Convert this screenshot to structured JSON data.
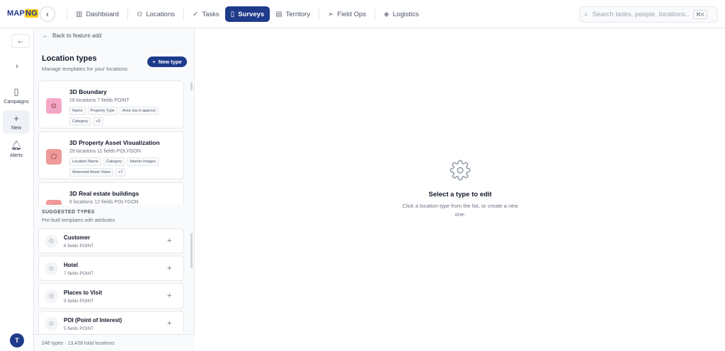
{
  "app": {
    "logo_main": "MAP",
    "logo_accent": "NG"
  },
  "nav": {
    "items": [
      {
        "label": "Dashboard",
        "icon": "bar-chart-icon",
        "active": false
      },
      {
        "label": "Locations",
        "icon": "map-pin-icon",
        "active": false
      },
      {
        "label": "Tasks",
        "icon": "check-icon",
        "active": false
      },
      {
        "label": "Surveys",
        "icon": "clipboard-icon",
        "active": true
      },
      {
        "label": "Territory",
        "icon": "map-icon",
        "active": false
      },
      {
        "label": "Field Ops",
        "icon": "send-icon",
        "active": false
      },
      {
        "label": "Logistics",
        "icon": "box-icon",
        "active": false
      }
    ]
  },
  "search": {
    "placeholder": "Search tasks, people, locations...",
    "shortcut": "⌘K"
  },
  "rail": {
    "campaigns": "Campaigns",
    "new": "New",
    "alerts": "Alerts",
    "avatar": "T"
  },
  "panel": {
    "back_label": "Back to feature add",
    "title": "Location types",
    "subtitle": "Manage templates for your locations",
    "new_type": "New type",
    "types": [
      {
        "name": "3D Boundary",
        "meta": "16 locations   7 fields   POINT",
        "icon": "map-pin-icon",
        "color": "#f2a7c6",
        "chips": [
          "Name",
          "Property Type",
          "Area (sq m approx)",
          "Category",
          "+3"
        ]
      },
      {
        "name": "3D Property Asset Visualization",
        "meta": "29 locations   11 fields   POLYGON",
        "icon": "polygon-icon",
        "color": "#ef9a9a",
        "chips": [
          "Location Name",
          "Category",
          "Interior Images",
          "Assessed Asset Value",
          "+7"
        ]
      },
      {
        "name": "3D Real estate buildings",
        "meta": "6 locations   12 fields   POLYGON",
        "icon": "polygon-icon",
        "color": "#ef9a9a",
        "chips": []
      }
    ],
    "suggested_title": "SUGGESTED TYPES",
    "suggested_subtitle": "Pre-built templates with attributes",
    "suggested": [
      {
        "name": "Customer",
        "meta": "6 fields   POINT"
      },
      {
        "name": "Hotel",
        "meta": "7 fields   POINT"
      },
      {
        "name": "Places to Visit",
        "meta": "9 fields   POINT"
      },
      {
        "name": "POI (Point of Interest)",
        "meta": "5 fields   POINT"
      }
    ],
    "footer": "246 types · 13,428 total locations"
  },
  "main": {
    "empty_title": "Select a type to edit",
    "empty_desc": "Click a location type from the list, or create a new one."
  }
}
